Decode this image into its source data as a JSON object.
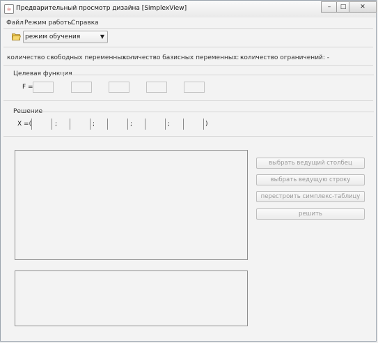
{
  "window": {
    "title": "Предварительный просмотр дизайна [SimplexView]",
    "app_icon": "java-icon",
    "controls": {
      "minimize": "–",
      "maximize": "□",
      "close": "✕"
    }
  },
  "menu": {
    "items": [
      {
        "label": "Файл"
      },
      {
        "label": "Режим работы"
      },
      {
        "label": "Справка"
      }
    ]
  },
  "toolbar": {
    "open_icon": "folder-open-icon",
    "mode_select": {
      "value": "режим обучения",
      "arrow": "▼"
    }
  },
  "stats": {
    "free_vars": "количество свободных переменных: -",
    "basis_vars": "количество базисных переменных: -",
    "constraints": "количество ограничений: -"
  },
  "objective": {
    "group_title": "Целевая функция",
    "label": "F ="
  },
  "solution": {
    "group_title": "Решение",
    "prefix": "X =(",
    "separator": ";",
    "suffix": ")"
  },
  "actions": {
    "choose_column": "выбрать ведущий столбец",
    "choose_row": "выбрать ведущую строку",
    "rebuild_table": "перестроить симплекс-таблицу",
    "solve": "решить"
  },
  "colors": {
    "window_bg": "#f3f3f3",
    "disabled_text": "#9a9a9a",
    "panel_border": "#8f8f8f"
  }
}
